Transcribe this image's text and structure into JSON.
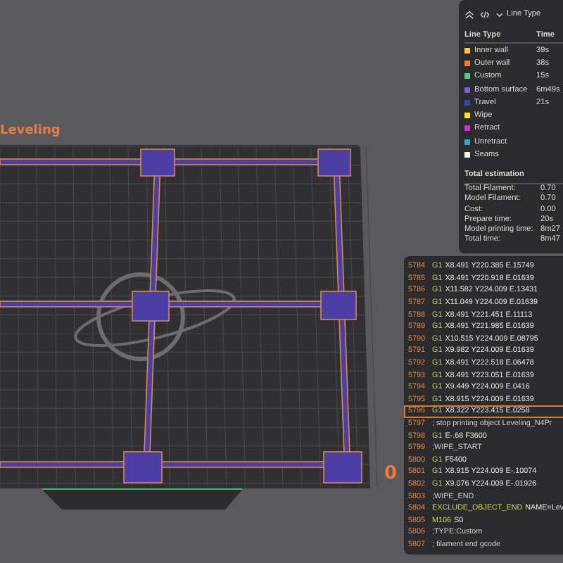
{
  "viewport": {
    "object_label": "Leveling",
    "layer_label": "0"
  },
  "legend": {
    "view_mode": "Line Type",
    "columns": [
      "Line Type",
      "Time"
    ],
    "items": [
      {
        "name": "Inner wall",
        "time": "39s",
        "color": "#ffc93a"
      },
      {
        "name": "Outer wall",
        "time": "38s",
        "color": "#ff7a33"
      },
      {
        "name": "Custom",
        "time": "15s",
        "color": "#4fcf8b"
      },
      {
        "name": "Bottom surface",
        "time": "6m49s",
        "color": "#7a5ad8"
      },
      {
        "name": "Travel",
        "time": "21s",
        "color": "#3a45a8"
      },
      {
        "name": "Wipe",
        "color": "#ffe800"
      },
      {
        "name": "Retract",
        "color": "#d12ed8"
      },
      {
        "name": "Unretract",
        "color": "#35a7c9"
      },
      {
        "name": "Seams",
        "color": "#f2f2f2"
      }
    ],
    "total_title": "Total estimation",
    "totals": [
      {
        "label": "Total Filament:",
        "value": "0.70"
      },
      {
        "label": "Model Filament:",
        "value": "0.70"
      },
      {
        "label": "Cost:",
        "value": "0.00"
      },
      {
        "label": "Prepare time:",
        "value": "20s"
      },
      {
        "label": "Model printing time:",
        "value": "8m27"
      },
      {
        "label": "Total time:",
        "value": "8m47"
      }
    ]
  },
  "gcode": {
    "lines": [
      {
        "num": "5784",
        "cmd": "G1",
        "args": "X8.491 Y220.385 E.15749",
        "selected": false
      },
      {
        "num": "5785",
        "cmd": "G1",
        "args": "X8.491 Y220.918 E.01639",
        "selected": false
      },
      {
        "num": "5786",
        "cmd": "G1",
        "args": "X11.582 Y224.009 E.13431",
        "selected": false
      },
      {
        "num": "5787",
        "cmd": "G1",
        "args": "X11.049 Y224.009 E.01639",
        "selected": false
      },
      {
        "num": "5788",
        "cmd": "G1",
        "args": "X8.491 Y221.451 E.11113",
        "selected": false
      },
      {
        "num": "5789",
        "cmd": "G1",
        "args": "X8.491 Y221.985 E.01639",
        "selected": false
      },
      {
        "num": "5790",
        "cmd": "G1",
        "args": "X10.515 Y224.009 E.08795",
        "selected": false
      },
      {
        "num": "5791",
        "cmd": "G1",
        "args": "X9.982 Y224.009 E.01639",
        "selected": false
      },
      {
        "num": "5792",
        "cmd": "G1",
        "args": "X8.491 Y222.518 E.06478",
        "selected": false
      },
      {
        "num": "5793",
        "cmd": "G1",
        "args": "X8.491 Y223.051 E.01639",
        "selected": false
      },
      {
        "num": "5794",
        "cmd": "G1",
        "args": "X9.449 Y224.009 E.0416",
        "selected": false
      },
      {
        "num": "5795",
        "cmd": "G1",
        "args": "X8.915 Y224.009 E.01639",
        "selected": false
      },
      {
        "num": "5796",
        "cmd": "G1",
        "args": "X8.322 Y223.415 E.0258",
        "selected": true
      },
      {
        "num": "5797",
        "args": "; stop printing object Leveling_N4Pr",
        "selected": false
      },
      {
        "num": "5798",
        "cmd": "G1",
        "args": "E-.68 F3600",
        "selected": false
      },
      {
        "num": "5799",
        "args": ";WIPE_START",
        "selected": false
      },
      {
        "num": "5800",
        "cmd": "G1",
        "args": "F5400",
        "selected": false
      },
      {
        "num": "5801",
        "cmd": "G1",
        "args": "X8.915 Y224.009 E-.10074",
        "selected": false
      },
      {
        "num": "5802",
        "cmd": "G1",
        "args": "X9.076 Y224.009 E-.01926",
        "selected": false
      },
      {
        "num": "5803",
        "args": ";WIPE_END",
        "selected": false
      },
      {
        "num": "5804",
        "cmd": "EXCLUDE_OBJECT_END",
        "args": "NAME=Lev",
        "selected": false
      },
      {
        "num": "5805",
        "cmd": "M106",
        "args": "S0",
        "selected": false
      },
      {
        "num": "5806",
        "args": ";TYPE:Custom",
        "selected": false
      },
      {
        "num": "5807",
        "args": "; filament end gcode",
        "selected": false
      }
    ]
  }
}
